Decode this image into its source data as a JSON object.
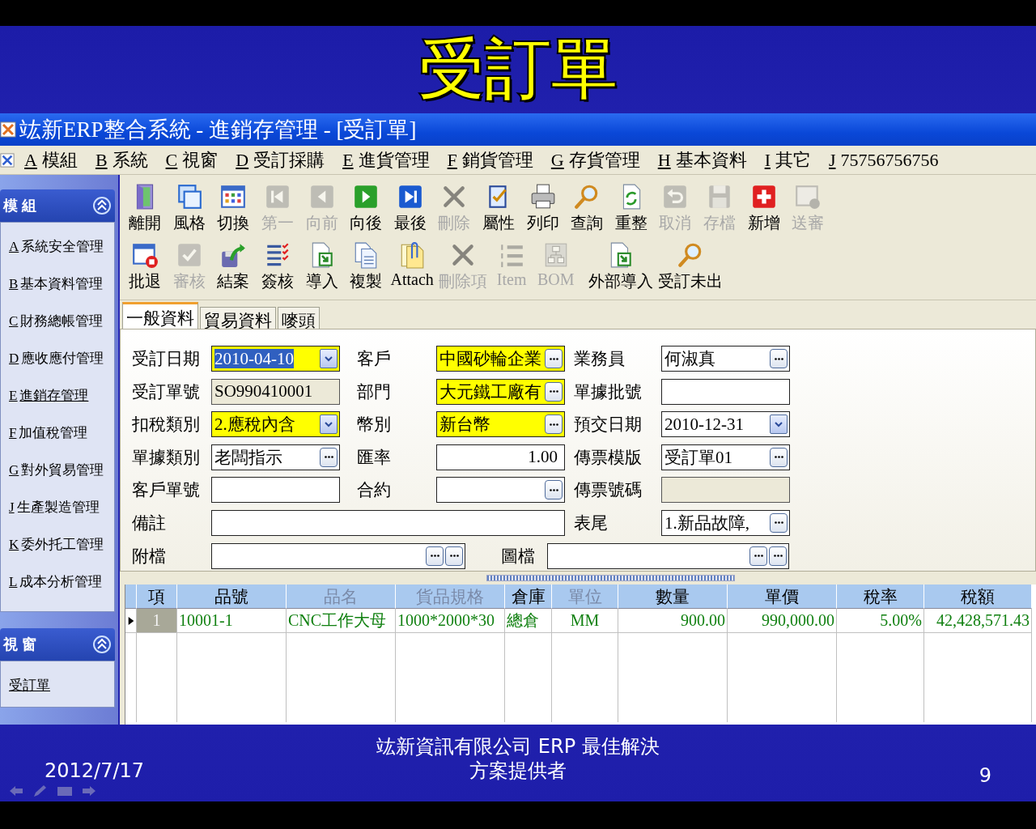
{
  "slide": {
    "title": "受訂單",
    "date": "2012/7/17",
    "footer_text": "竑新資訊有限公司 ERP 最佳解決方案提供者",
    "page_number": "9"
  },
  "window": {
    "title": "竑新ERP整合系統 - 進銷存管理 - [受訂單]"
  },
  "menu": [
    {
      "key": "A",
      "label": "模組"
    },
    {
      "key": "B",
      "label": "系統"
    },
    {
      "key": "C",
      "label": "視窗"
    },
    {
      "key": "D",
      "label": "受訂採購"
    },
    {
      "key": "E",
      "label": "進貨管理"
    },
    {
      "key": "F",
      "label": "銷貨管理"
    },
    {
      "key": "G",
      "label": "存貨管理"
    },
    {
      "key": "H",
      "label": "基本資料"
    },
    {
      "key": "I",
      "label": "其它"
    },
    {
      "key": "J",
      "label": "75756756756"
    }
  ],
  "sidebar": {
    "panels": [
      {
        "title": "模 組",
        "expanded": true,
        "items": [
          {
            "key": "A",
            "label": "系統安全管理",
            "selected": false
          },
          {
            "key": "B",
            "label": "基本資料管理",
            "selected": false
          },
          {
            "key": "C",
            "label": "財務總帳管理",
            "selected": false
          },
          {
            "key": "D",
            "label": "應收應付管理",
            "selected": false
          },
          {
            "key": "E",
            "label": "進銷存管理",
            "selected": true
          },
          {
            "key": "F",
            "label": "加值稅管理",
            "selected": false
          },
          {
            "key": "G",
            "label": "對外貿易管理",
            "selected": false
          },
          {
            "key": "J",
            "label": "生產製造管理",
            "selected": false
          },
          {
            "key": "K",
            "label": "委外托工管理",
            "selected": false
          },
          {
            "key": "L",
            "label": "成本分析管理",
            "selected": false
          }
        ]
      },
      {
        "title": "視 窗",
        "expanded": true,
        "items": [
          {
            "label": "受訂單",
            "selected": true
          }
        ]
      }
    ]
  },
  "toolbar": {
    "top_row": [
      {
        "label": "離開",
        "disabled": false
      },
      {
        "label": "風格",
        "disabled": false
      },
      {
        "label": "切換",
        "disabled": false
      },
      {
        "label": "第一",
        "disabled": true
      },
      {
        "label": "向前",
        "disabled": true
      },
      {
        "label": "向後",
        "disabled": false
      },
      {
        "label": "最後",
        "disabled": false
      },
      {
        "label": "刪除",
        "disabled": true
      },
      {
        "label": "屬性",
        "disabled": false
      },
      {
        "label": "列印",
        "disabled": false
      },
      {
        "label": "查詢",
        "disabled": false
      },
      {
        "label": "重整",
        "disabled": false
      },
      {
        "label": "取消",
        "disabled": true
      },
      {
        "label": "存檔",
        "disabled": true
      },
      {
        "label": "新增",
        "disabled": false
      },
      {
        "label": "送審",
        "disabled": true
      }
    ],
    "bottom_row": [
      {
        "label": "批退",
        "disabled": false
      },
      {
        "label": "審核",
        "disabled": true
      },
      {
        "label": "結案",
        "disabled": false
      },
      {
        "label": "簽核",
        "disabled": false
      },
      {
        "label": "導入",
        "disabled": false
      },
      {
        "label": "複製",
        "disabled": false
      },
      {
        "label": "Attach",
        "disabled": false
      },
      {
        "label": "刪除項",
        "disabled": true
      },
      {
        "label": "Item",
        "disabled": true
      },
      {
        "label": "BOM",
        "disabled": true
      },
      {
        "label": "外部導入",
        "disabled": false
      },
      {
        "label": "受訂未出",
        "disabled": false
      }
    ]
  },
  "tabs": [
    {
      "label": "一般資料",
      "selected": true
    },
    {
      "label": "貿易資料",
      "selected": false
    },
    {
      "label": "嘜頭",
      "selected": false
    }
  ],
  "form": {
    "fields": [
      {
        "label": "受訂日期",
        "kind": "combo",
        "value": "2010-04-10",
        "required": true,
        "value_selected": true
      },
      {
        "label": "客戶",
        "kind": "lookup",
        "value": "中國砂輪企業",
        "required": true,
        "value_selected": false
      },
      {
        "label": "業務員",
        "kind": "lookup",
        "value": "何淑真",
        "required": false,
        "value_selected": false
      },
      {
        "label": "受訂單號",
        "kind": "readonly",
        "value": "SO990410001",
        "required": false,
        "value_selected": false
      },
      {
        "label": "部門",
        "kind": "lookup",
        "value": "大元鐵工廠有",
        "required": true,
        "value_selected": false
      },
      {
        "label": "單據批號",
        "kind": "text",
        "required": false
      },
      {
        "label": "扣稅類別",
        "kind": "combo",
        "value": "2.應稅內含",
        "required": true,
        "value_selected": false
      },
      {
        "label": "幣別",
        "kind": "lookup",
        "value": "新台幣",
        "required": true,
        "value_selected": false
      },
      {
        "label": "預交日期",
        "kind": "combo",
        "value": "2010-12-31",
        "required": false,
        "value_selected": false
      },
      {
        "label": "單據類別",
        "kind": "lookup",
        "value": "老闆指示",
        "required": false,
        "value_selected": false
      },
      {
        "label": "匯率",
        "kind": "number",
        "value": "1.00",
        "required": false,
        "value_selected": false
      },
      {
        "label": "傳票模版",
        "kind": "lookup",
        "value": "受訂單01",
        "required": false,
        "value_selected": false
      },
      {
        "label": "客戶單號",
        "kind": "text",
        "required": false
      },
      {
        "label": "合約",
        "kind": "lookup",
        "required": false
      },
      {
        "label": "傳票號碼",
        "kind": "readonly",
        "required": false
      },
      {
        "label": "備註",
        "kind": "wide",
        "required": false
      },
      {
        "label": "表尾",
        "kind": "lookup",
        "value": "1.新品故障,",
        "required": false,
        "value_selected": false
      }
    ],
    "attachments": [
      {
        "label": "附檔",
        "kind": "double_lookup"
      },
      {
        "label": "圖檔",
        "kind": "double_lookup"
      }
    ]
  },
  "grid": {
    "columns": [
      {
        "label": "項",
        "kind": "center",
        "disabled": false
      },
      {
        "label": "品號",
        "kind": "text",
        "disabled": false
      },
      {
        "label": "品名",
        "kind": "text",
        "disabled": true
      },
      {
        "label": "貨品規格",
        "kind": "text",
        "disabled": true
      },
      {
        "label": "倉庫",
        "kind": "text",
        "disabled": false
      },
      {
        "label": "單位",
        "kind": "center",
        "disabled": true
      },
      {
        "label": "數量",
        "kind": "number",
        "disabled": false
      },
      {
        "label": "單價",
        "kind": "number",
        "disabled": false
      },
      {
        "label": "稅率",
        "kind": "number",
        "disabled": false
      },
      {
        "label": "稅額",
        "kind": "number",
        "disabled": false
      }
    ],
    "rows": [
      {
        "current": true,
        "cells": [
          "1",
          "10001-1",
          "CNC工作大母",
          "1000*2000*30",
          "總倉",
          "MM",
          "900.00",
          "990,000.00",
          "5.00%",
          "42,428,571.43"
        ]
      }
    ]
  }
}
